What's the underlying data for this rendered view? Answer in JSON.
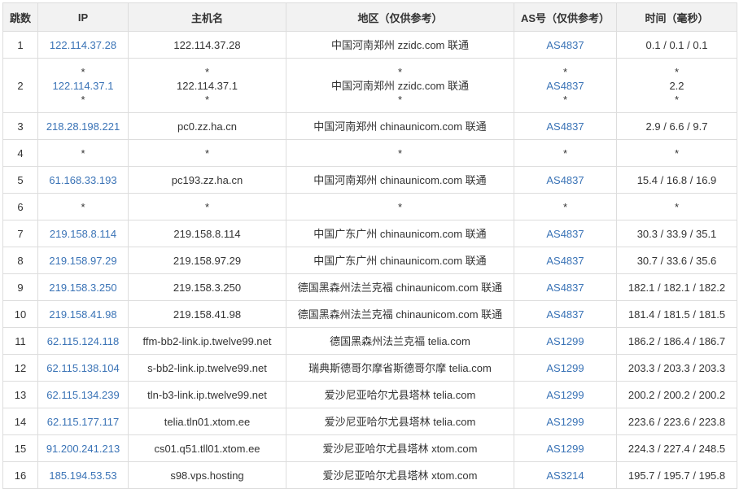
{
  "colors": {
    "link": "#3a73b6",
    "header_bg": "#f2f2f2",
    "border": "#dddddd",
    "text": "#333333"
  },
  "headers": [
    "跳数",
    "IP",
    "主机名",
    "地区（仅供参考）",
    "AS号（仅供参考）",
    "时间（毫秒）"
  ],
  "rows": [
    {
      "hop": "1",
      "ip": [
        "122.114.37.28"
      ],
      "host": [
        "122.114.37.28"
      ],
      "region": [
        "中国河南郑州 zzidc.com 联通"
      ],
      "as": [
        "AS4837"
      ],
      "time": [
        "0.1 / 0.1 / 0.1"
      ]
    },
    {
      "hop": "2",
      "ip": [
        "*",
        "122.114.37.1",
        "*"
      ],
      "host": [
        "*",
        "122.114.37.1",
        "*"
      ],
      "region": [
        "*",
        "中国河南郑州 zzidc.com 联通",
        "*"
      ],
      "as": [
        "*",
        "AS4837",
        "*"
      ],
      "time": [
        "*",
        "2.2",
        "*"
      ]
    },
    {
      "hop": "3",
      "ip": [
        "218.28.198.221"
      ],
      "host": [
        "pc0.zz.ha.cn"
      ],
      "region": [
        "中国河南郑州 chinaunicom.com 联通"
      ],
      "as": [
        "AS4837"
      ],
      "time": [
        "2.9 / 6.6 / 9.7"
      ]
    },
    {
      "hop": "4",
      "ip": [
        "*"
      ],
      "host": [
        "*"
      ],
      "region": [
        "*"
      ],
      "as": [
        "*"
      ],
      "time": [
        "*"
      ]
    },
    {
      "hop": "5",
      "ip": [
        "61.168.33.193"
      ],
      "host": [
        "pc193.zz.ha.cn"
      ],
      "region": [
        "中国河南郑州 chinaunicom.com 联通"
      ],
      "as": [
        "AS4837"
      ],
      "time": [
        "15.4 / 16.8 / 16.9"
      ]
    },
    {
      "hop": "6",
      "ip": [
        "*"
      ],
      "host": [
        "*"
      ],
      "region": [
        "*"
      ],
      "as": [
        "*"
      ],
      "time": [
        "*"
      ]
    },
    {
      "hop": "7",
      "ip": [
        "219.158.8.114"
      ],
      "host": [
        "219.158.8.114"
      ],
      "region": [
        "中国广东广州 chinaunicom.com 联通"
      ],
      "as": [
        "AS4837"
      ],
      "time": [
        "30.3 / 33.9 / 35.1"
      ]
    },
    {
      "hop": "8",
      "ip": [
        "219.158.97.29"
      ],
      "host": [
        "219.158.97.29"
      ],
      "region": [
        "中国广东广州 chinaunicom.com 联通"
      ],
      "as": [
        "AS4837"
      ],
      "time": [
        "30.7 / 33.6 / 35.6"
      ]
    },
    {
      "hop": "9",
      "ip": [
        "219.158.3.250"
      ],
      "host": [
        "219.158.3.250"
      ],
      "region": [
        "德国黑森州法兰克福 chinaunicom.com 联通"
      ],
      "as": [
        "AS4837"
      ],
      "time": [
        "182.1 / 182.1 / 182.2"
      ]
    },
    {
      "hop": "10",
      "ip": [
        "219.158.41.98"
      ],
      "host": [
        "219.158.41.98"
      ],
      "region": [
        "德国黑森州法兰克福 chinaunicom.com 联通"
      ],
      "as": [
        "AS4837"
      ],
      "time": [
        "181.4 / 181.5 / 181.5"
      ]
    },
    {
      "hop": "11",
      "ip": [
        "62.115.124.118"
      ],
      "host": [
        "ffm-bb2-link.ip.twelve99.net"
      ],
      "region": [
        "德国黑森州法兰克福 telia.com"
      ],
      "as": [
        "AS1299"
      ],
      "time": [
        "186.2 / 186.4 / 186.7"
      ]
    },
    {
      "hop": "12",
      "ip": [
        "62.115.138.104"
      ],
      "host": [
        "s-bb2-link.ip.twelve99.net"
      ],
      "region": [
        "瑞典斯德哥尔摩省斯德哥尔摩 telia.com"
      ],
      "as": [
        "AS1299"
      ],
      "time": [
        "203.3 / 203.3 / 203.3"
      ]
    },
    {
      "hop": "13",
      "ip": [
        "62.115.134.239"
      ],
      "host": [
        "tln-b3-link.ip.twelve99.net"
      ],
      "region": [
        "爱沙尼亚哈尔尤县塔林 telia.com"
      ],
      "as": [
        "AS1299"
      ],
      "time": [
        "200.2 / 200.2 / 200.2"
      ]
    },
    {
      "hop": "14",
      "ip": [
        "62.115.177.117"
      ],
      "host": [
        "telia.tln01.xtom.ee"
      ],
      "region": [
        "爱沙尼亚哈尔尤县塔林 telia.com"
      ],
      "as": [
        "AS1299"
      ],
      "time": [
        "223.6 / 223.6 / 223.8"
      ]
    },
    {
      "hop": "15",
      "ip": [
        "91.200.241.213"
      ],
      "host": [
        "cs01.q51.tll01.xtom.ee"
      ],
      "region": [
        "爱沙尼亚哈尔尤县塔林 xtom.com"
      ],
      "as": [
        "AS1299"
      ],
      "time": [
        "224.3 / 227.4 / 248.5"
      ]
    },
    {
      "hop": "16",
      "ip": [
        "185.194.53.53"
      ],
      "host": [
        "s98.vps.hosting"
      ],
      "region": [
        "爱沙尼亚哈尔尤县塔林 xtom.com"
      ],
      "as": [
        "AS3214"
      ],
      "time": [
        "195.7 / 195.7 / 195.8"
      ]
    }
  ]
}
